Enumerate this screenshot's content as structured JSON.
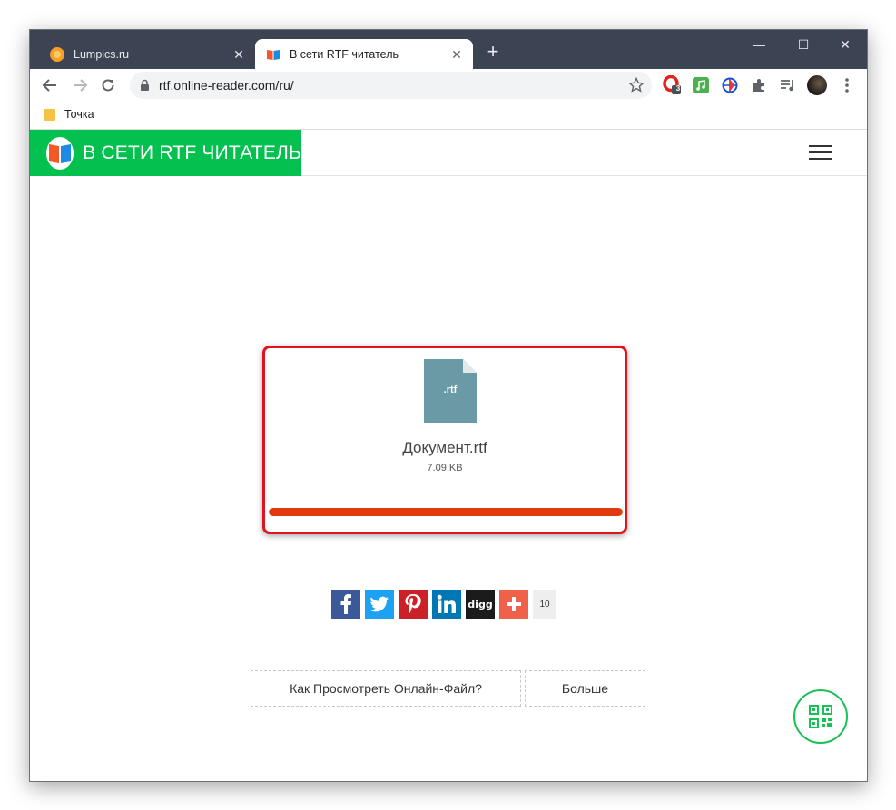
{
  "browser": {
    "tabs": [
      {
        "label": "Lumpics.ru",
        "active": false,
        "icon": "orange-icon"
      },
      {
        "label": "В сети RTF читатель",
        "active": true,
        "icon": "book-icon"
      }
    ],
    "new_tab": "+",
    "url": "rtf.online-reader.com/ru/",
    "extension_badge": "3",
    "bookmarks": [
      {
        "label": "Точка"
      }
    ]
  },
  "site": {
    "title": "В СЕТИ RTF ЧИТАТЕЛЬ",
    "brand_color": "#04c04f"
  },
  "file": {
    "ext_label": ".rtf",
    "name": "Документ.rtf",
    "size": "7.09 KB",
    "progress": 1.0,
    "progress_color": "#e03a0e"
  },
  "share": {
    "networks": [
      "facebook",
      "twitter",
      "pinterest",
      "linkedin",
      "digg",
      "more"
    ],
    "digg_label": "digg",
    "count": "10"
  },
  "buttons": {
    "how_to": "Как Просмотреть Онлайн-Файл?",
    "more": "Больше"
  },
  "highlight_color": "#e0141e"
}
